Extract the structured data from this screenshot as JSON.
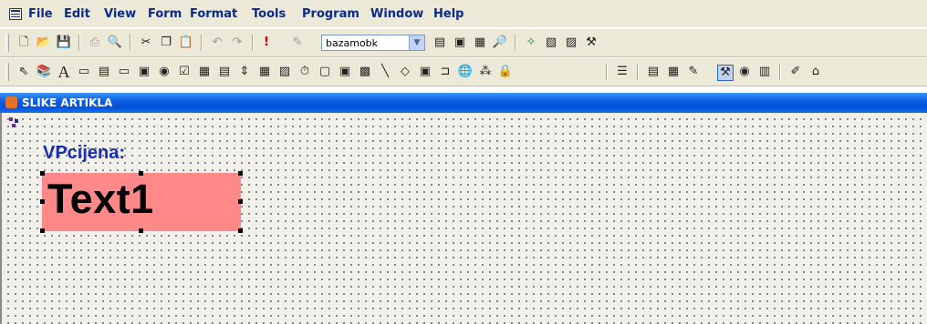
{
  "menu": {
    "items": [
      "File",
      "Edit",
      "View",
      "Form",
      "Format",
      "Tools",
      "Program",
      "Window",
      "Help"
    ]
  },
  "toolbar1": {
    "icons": [
      "new-icon",
      "open-icon",
      "save-icon",
      "print-icon",
      "print-preview-icon",
      "cut-icon",
      "copy-icon",
      "paste-icon",
      "undo-icon",
      "redo-icon",
      "run-icon",
      "modify-icon",
      "database-icon",
      "command-window-icon",
      "form-control-toolbar-icon",
      "properties-icon",
      "code-icon",
      "data-environment-icon",
      "wizard-icon"
    ],
    "combo_value": "bazamobk"
  },
  "toolbar2": {
    "icons": [
      "select-objects-icon",
      "view-classes-icon",
      "label-tool-icon",
      "textbox-tool-icon",
      "editbox-tool-icon",
      "command-button-tool-icon",
      "command-group-tool-icon",
      "option-group-tool-icon",
      "checkbox-tool-icon",
      "combobox-tool-icon",
      "listbox-tool-icon",
      "spinner-tool-icon",
      "grid-tool-icon",
      "image-tool-icon",
      "timer-tool-icon",
      "pageframe-tool-icon",
      "ole-container-tool-icon",
      "ole-bound-tool-icon",
      "line-tool-icon",
      "shape-tool-icon",
      "container-tool-icon",
      "separator-tool-icon",
      "hyperlink-tool-icon",
      "builder-lock-icon",
      "button-lock-icon",
      "tab-order-icon",
      "data-environment-icon",
      "properties-window-icon",
      "code-window-icon",
      "form-control-toolbar-icon",
      "color-palette-icon",
      "layout-toolbar-icon",
      "form-builder-icon",
      "autoformat-icon"
    ]
  },
  "form": {
    "title": "SLIKE ARTIKLA",
    "label": "VPcijena:",
    "textbox": "Text1",
    "textbox_color": "#ff8888",
    "label_color": "#1a2fb0"
  }
}
